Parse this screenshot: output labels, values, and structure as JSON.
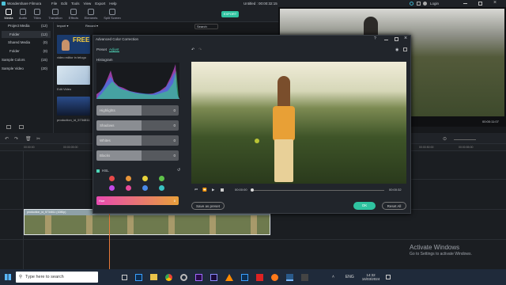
{
  "app": {
    "name": "Wondershare Filmora",
    "menus": [
      "File",
      "Edit",
      "Tools",
      "View",
      "Export",
      "Help"
    ],
    "title": "Untitled : 00:00:32:15",
    "login": "Login"
  },
  "toptabs": [
    "Media",
    "Audio",
    "Titles",
    "Transition",
    "Effects",
    "Elements",
    "Split Screen"
  ],
  "export_label": "EXPORT",
  "left": {
    "items": [
      {
        "label": "Project Media",
        "count": "(12)"
      },
      {
        "label": "Folder",
        "count": "(12)"
      },
      {
        "label": "Shared Media",
        "count": "(0)"
      },
      {
        "label": "Folder",
        "count": "(0)"
      },
      {
        "label": "Sample Colors",
        "count": "(15)"
      },
      {
        "label": "Sample Video",
        "count": "(20)"
      }
    ]
  },
  "media": {
    "import": "Import",
    "record": "Record",
    "search": "Search",
    "free_label": "FREE",
    "items": [
      "video editor in telugu",
      "Edit Video",
      "production_id_5734811"
    ]
  },
  "dialog": {
    "title": "Advanced Color Correction",
    "tabs": [
      "Preset",
      "Adjust"
    ],
    "histogram_label": "Histogram",
    "sliders": [
      {
        "label": "Highlights",
        "value": "0",
        "level": 0.55
      },
      {
        "label": "Shadows",
        "value": "0",
        "level": 0.55
      },
      {
        "label": "Whites",
        "value": "0",
        "level": 0.55
      },
      {
        "label": "Blacks",
        "value": "0",
        "level": 0.55
      }
    ],
    "hsl_label": "HSL",
    "hsl_colors": [
      "#e84a4a",
      "#e8953a",
      "#e8d23a",
      "#5fc24a",
      "#c44ae8",
      "#e84a9a",
      "#4a8ae8",
      "#3ac2c2"
    ],
    "hue_label": "Hue",
    "hue_value": "0",
    "time_start": "00:00:00",
    "time_end": "00:00:32",
    "save_preset": "Save as preset",
    "ok": "OK",
    "reset_all": "Reset All"
  },
  "preview": {
    "timecode": "00:00:11:07",
    "ratio": "1/2"
  },
  "timeline": {
    "clip_label": "production_id_5734811 (1080p)",
    "ruler": [
      "00:00:00",
      "00:00:05:00",
      "00:00:10:00",
      "00:00:15:00",
      "00:00:20:00",
      "00:00:25:00",
      "00:00:30:00",
      "00:00:35:00",
      "00:00:40:00",
      "00:00:45:00",
      "00:00:50:00",
      "00:00:55:00"
    ]
  },
  "watermark": {
    "title": "Activate Windows",
    "subtitle": "Go to Settings to activate Windows."
  },
  "taskbar": {
    "search": "Type here to search",
    "lang": "ENG",
    "time": "14:32",
    "date": "16/03/2024"
  }
}
